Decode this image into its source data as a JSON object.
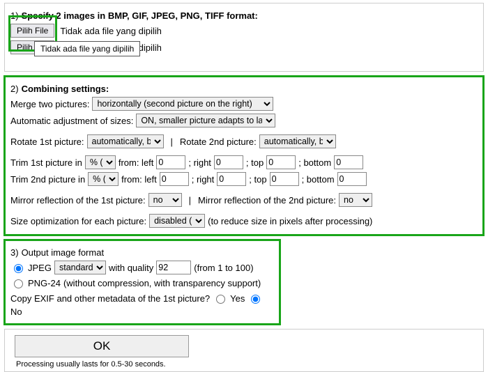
{
  "section1": {
    "title": "Specify 2 images in BMP, GIF, JPEG, PNG, TIFF format:",
    "pick_label": "Pilih File",
    "no_file": "Tidak ada file yang dipilih",
    "tooltip": "Tidak ada file yang dipilih"
  },
  "section2": {
    "title": "Combining settings:",
    "merge_label": "Merge two pictures:",
    "merge_value": "horizontally (second picture on the right)",
    "autosize_label": "Automatic adjustment of sizes:",
    "autosize_value": "ON, smaller picture adapts to la",
    "rotate1_label": "Rotate 1st picture:",
    "rotate1_value": "automatically, b",
    "rotate2_label": "Rotate 2nd picture:",
    "rotate2_value": "automatically, b",
    "trim1_label": "Trim 1st picture in",
    "trim2_label": "Trim 2nd picture in",
    "unit": "% (",
    "from_left": "from: left",
    "right": "; right",
    "top": "; top",
    "bottom": "; bottom",
    "trim_zero": "0",
    "mirror1_label": "Mirror reflection of the 1st picture:",
    "mirror2_label": "Mirror reflection of the 2nd picture:",
    "mirror_value": "no",
    "sizeopt_label": "Size optimization for each picture:",
    "sizeopt_value": "disabled (",
    "sizeopt_hint": "(to reduce size in pixels after processing)"
  },
  "section3": {
    "title": "Output image format",
    "jpeg_label": "JPEG",
    "jpeg_quality_value": "standard",
    "with_quality": "with quality",
    "quality_num": "92",
    "quality_hint": "(from 1 to 100)",
    "png_label": "PNG-24",
    "png_hint": "(without compression, with transparency support)",
    "exif_label": "Copy EXIF and other metadata of the 1st picture?",
    "yes": "Yes",
    "no": "No"
  },
  "submit": {
    "ok": "OK",
    "footer": "Processing usually lasts for 0.5-30 seconds."
  }
}
